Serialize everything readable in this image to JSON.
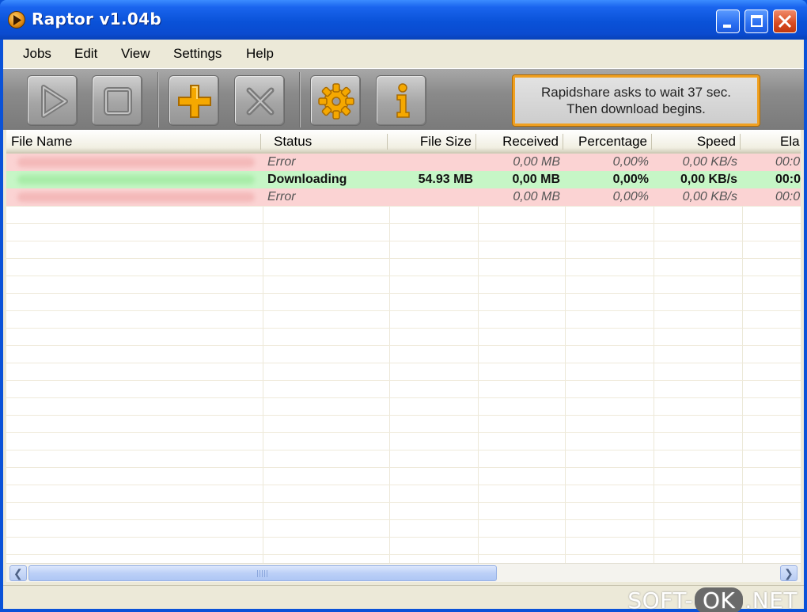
{
  "window": {
    "title": "Raptor v1.04b",
    "icons": {
      "app": "raptor-app-icon",
      "minimize": "minimize-icon",
      "maximize": "maximize-icon",
      "close": "close-icon"
    }
  },
  "menu": {
    "items": [
      "Jobs",
      "Edit",
      "View",
      "Settings",
      "Help"
    ]
  },
  "toolbar": {
    "buttons": [
      {
        "name": "start",
        "icon": "play-icon"
      },
      {
        "name": "stop",
        "icon": "stop-icon"
      },
      {
        "name": "add",
        "icon": "plus-icon"
      },
      {
        "name": "remove",
        "icon": "cross-icon"
      },
      {
        "name": "settings",
        "icon": "gear-icon"
      },
      {
        "name": "info",
        "icon": "info-icon"
      }
    ],
    "status_message": {
      "line1": "Rapidshare asks to wait 37 sec.",
      "line2": "Then download begins."
    },
    "colors": {
      "accent": "#f0a020",
      "icon": "#f5a800"
    }
  },
  "columns": [
    "File Name",
    "Status",
    "File Size",
    "Received",
    "Percentage",
    "Speed",
    "Ela"
  ],
  "rows": [
    {
      "state": "error",
      "file_name": "",
      "status": "Error",
      "file_size": "",
      "received": "0,00 MB",
      "percentage": "0,00%",
      "speed": "0,00 KB/s",
      "elapsed": "00:0"
    },
    {
      "state": "ok",
      "file_name": "",
      "status": "Downloading",
      "file_size": "54.93 MB",
      "received": "0,00 MB",
      "percentage": "0,00%",
      "speed": "0,00 KB/s",
      "elapsed": "00:0"
    },
    {
      "state": "error",
      "file_name": "",
      "status": "Error",
      "file_size": "",
      "received": "0,00 MB",
      "percentage": "0,00%",
      "speed": "0,00 KB/s",
      "elapsed": "00:0"
    }
  ],
  "row_colors": {
    "error": "#fbd3d3",
    "ok": "#c6f6c6"
  },
  "scrollbar": {
    "icons": {
      "left": "arrow-left-icon",
      "right": "arrow-right-icon"
    }
  },
  "watermark": {
    "part1": "SOFT-",
    "part2": "OK",
    "part3": ".NET"
  }
}
